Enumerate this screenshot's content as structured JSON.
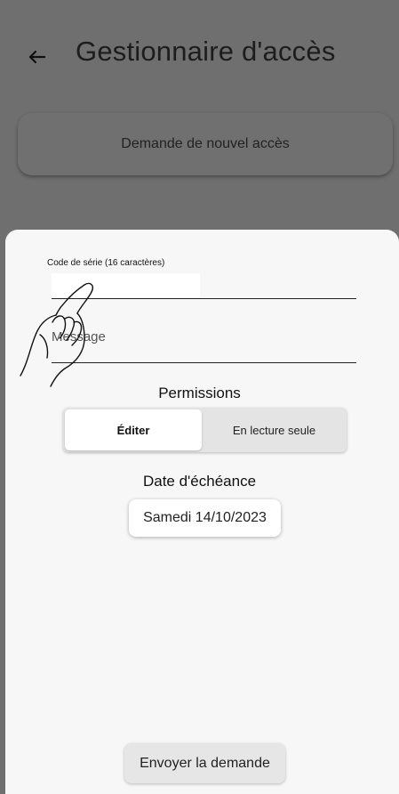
{
  "app_bar": {
    "title": "Gestionnaire d'accès",
    "back_icon": "arrow-left-icon"
  },
  "new_access_card": {
    "label": "Demande de nouvel accès"
  },
  "form": {
    "serial": {
      "label": "Code de série (16 caractères)",
      "value": ""
    },
    "message": {
      "label": "Message"
    },
    "permissions": {
      "title": "Permissions",
      "options": [
        "Éditer",
        "En lecture seule"
      ],
      "selected": "Éditer"
    },
    "due_date": {
      "title": "Date d'échéance",
      "value": "Samedi 14/10/2023"
    },
    "submit_label": "Envoyer la demande"
  },
  "colors": {
    "overlay": "#6f6f6f",
    "sheet": "#f7f7f7",
    "segment_selected": "#ffffff",
    "segment_track": "#e4e4e4"
  },
  "icons": [
    "arrow-left-icon",
    "hand-pointer-icon"
  ]
}
